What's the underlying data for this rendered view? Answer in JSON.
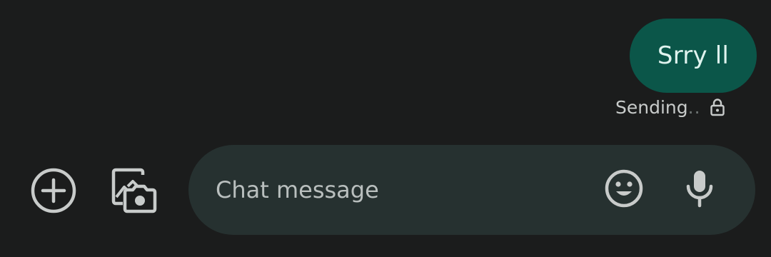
{
  "message": {
    "text": "Srry ll",
    "status_text": "Sending",
    "status_dots": "..",
    "bubble_color": "#0b5649",
    "status_icon": "lock-icon"
  },
  "composer": {
    "placeholder": "Chat message",
    "value": "",
    "left_icons": [
      "add-circle-icon",
      "gallery-camera-icon"
    ],
    "right_icons": [
      "emoji-icon",
      "microphone-icon"
    ],
    "background_color": "#263130"
  },
  "theme": {
    "background": "#1b1c1c",
    "icon_color": "#c8cbca"
  }
}
